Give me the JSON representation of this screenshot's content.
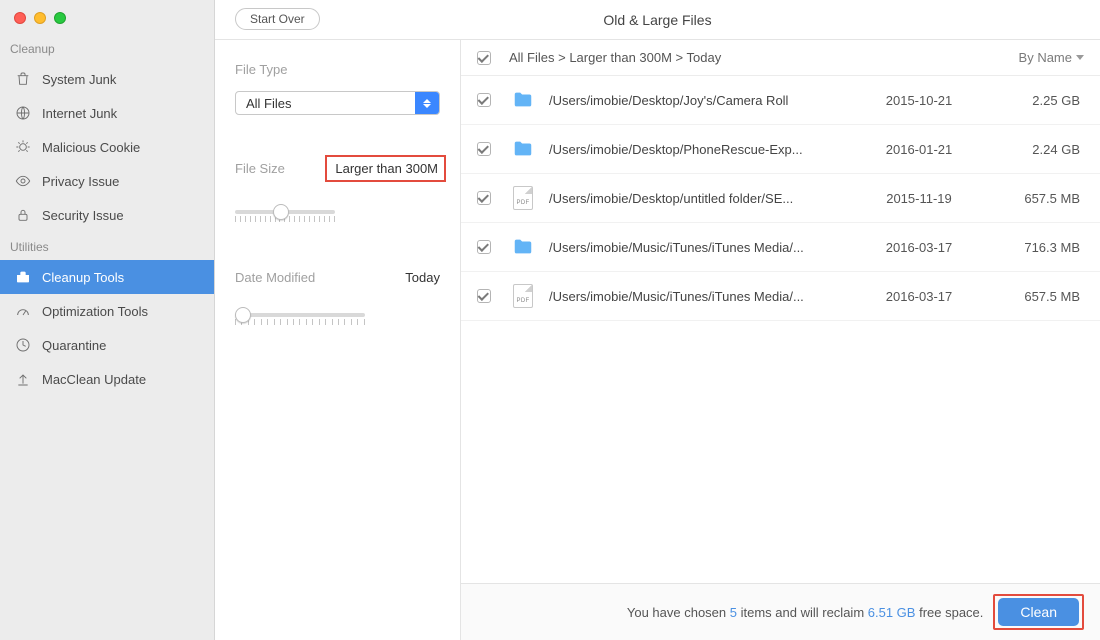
{
  "window": {
    "title": "Old & Large Files",
    "start_over": "Start Over"
  },
  "sidebar": {
    "sections": {
      "cleanup": {
        "label": "Cleanup",
        "items": [
          {
            "label": "System Junk"
          },
          {
            "label": "Internet Junk"
          },
          {
            "label": "Malicious Cookie"
          },
          {
            "label": "Privacy Issue"
          },
          {
            "label": "Security Issue"
          }
        ]
      },
      "utilities": {
        "label": "Utilities",
        "items": [
          {
            "label": "Cleanup Tools"
          },
          {
            "label": "Optimization Tools"
          },
          {
            "label": "Quarantine"
          },
          {
            "label": "MacClean Update"
          }
        ]
      }
    }
  },
  "filters": {
    "file_type": {
      "label": "File Type",
      "value": "All Files"
    },
    "file_size": {
      "label": "File Size",
      "value": "Larger than 300M"
    },
    "date_modified": {
      "label": "Date Modified",
      "value": "Today"
    }
  },
  "list": {
    "breadcrumb": "All Files > Larger than 300M > Today",
    "sort_label": "By Name",
    "rows": [
      {
        "icon": "folder",
        "path": "/Users/imobie/Desktop/Joy's/Camera Roll",
        "date": "2015-10-21",
        "size": "2.25 GB"
      },
      {
        "icon": "folder",
        "path": "/Users/imobie/Desktop/PhoneRescue-Exp...",
        "date": "2016-01-21",
        "size": "2.24 GB"
      },
      {
        "icon": "pdf",
        "path": "/Users/imobie/Desktop/untitled folder/SE...",
        "date": "2015-11-19",
        "size": "657.5 MB"
      },
      {
        "icon": "folder",
        "path": "/Users/imobie/Music/iTunes/iTunes Media/...",
        "date": "2016-03-17",
        "size": "716.3 MB"
      },
      {
        "icon": "pdf",
        "path": "/Users/imobie/Music/iTunes/iTunes Media/...",
        "date": "2016-03-17",
        "size": "657.5 MB"
      }
    ]
  },
  "footer": {
    "pre": "You have chosen ",
    "count": "5",
    "mid": " items and will reclaim ",
    "space": "6.51 GB",
    "post": " free space.",
    "clean": "Clean"
  }
}
